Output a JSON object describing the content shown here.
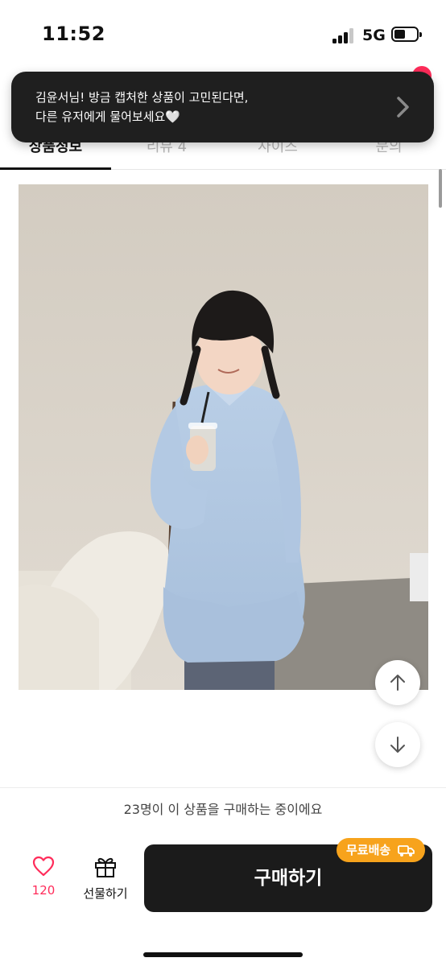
{
  "status_bar": {
    "time": "11:52",
    "network": "5G",
    "battery_level": 0.45
  },
  "tabs": [
    {
      "label": "상품정보",
      "active": true
    },
    {
      "label": "리뷰 4",
      "active": false
    },
    {
      "label": "사이즈",
      "active": false
    },
    {
      "label": "문의",
      "active": false
    }
  ],
  "toast": {
    "line1": "김윤서님! 방금 캡처한 상품이 고민된다면,",
    "line2": "다른 유저에게 물어보세요🤍"
  },
  "scroll_buttons": {
    "up_icon": "arrow-up-icon",
    "down_icon": "arrow-down-icon"
  },
  "purchase_strip": {
    "text": "23명이 이 상품을 구매하는 중이에요"
  },
  "bottom_bar": {
    "like_icon": "heart-outline-icon",
    "like_count": "120",
    "gift_icon": "gift-icon",
    "gift_label": "선물하기",
    "buy_label": "구매하기",
    "free_shipping_badge": "무료배송",
    "badge_icon": "delivery-truck-icon"
  },
  "colors": {
    "accent": "#ff2c5a",
    "badge": "#f7a31c",
    "buy_button": "#1b1b1b",
    "toast": "#1f1f1f"
  }
}
